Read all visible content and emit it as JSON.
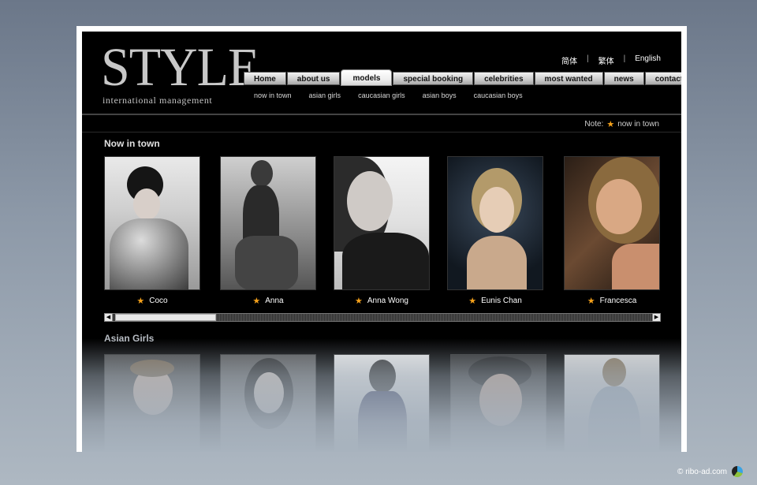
{
  "logo": {
    "title": "STYLE",
    "subtitle": "international management"
  },
  "language": {
    "items": [
      "简体",
      "繁体",
      "English"
    ],
    "separator": "|"
  },
  "nav": {
    "items": [
      "Home",
      "about us",
      "models",
      "special booking",
      "celebrities",
      "most wanted",
      "news",
      "contact us"
    ],
    "active": "models"
  },
  "subnav": {
    "items": [
      "now in town",
      "asian girls",
      "caucasian girls",
      "asian boys",
      "caucasian boys"
    ]
  },
  "note": {
    "label": "Note:",
    "text": "now in town",
    "icon": "star-icon"
  },
  "sections": {
    "now_in_town": {
      "title": "Now in town",
      "models": [
        "Coco",
        "Anna",
        "Anna Wong",
        "Eunis Chan",
        "Francesca"
      ]
    },
    "asian_girls": {
      "title": "Asian Girls"
    }
  },
  "footer": {
    "text": "© ribo-ad.com"
  },
  "colors": {
    "accent_star": "#f6a21b",
    "background": "#000000"
  }
}
